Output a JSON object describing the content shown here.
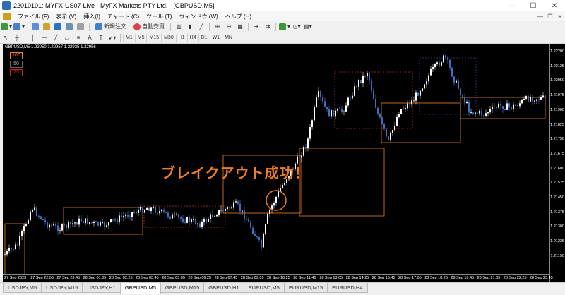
{
  "window": {
    "title": "22010101: MYFX-US07-Live - MyFX Markets PTY Ltd. - [GBPUSD,M5]",
    "minimize": "—",
    "maximize": "☐",
    "close": "✕"
  },
  "menu": [
    "ファイル (F)",
    "表示 (V)",
    "挿入(I)",
    "チャート (C)",
    "ツール (T)",
    "ウィンドウ (W)",
    "ヘルプ (H)"
  ],
  "menu_controls": [
    "—",
    "❐",
    "✕"
  ],
  "toolbar1": {
    "new_order": "新規注文",
    "auto_trade": "自動売買"
  },
  "toolbar2": {
    "timeframes": [
      "M1",
      "M5",
      "M15",
      "M30",
      "H1",
      "H4",
      "D1",
      "W1",
      "MN"
    ]
  },
  "chart": {
    "symbol_info": "GBPUSD,M5  1.22950 1.22957 1.22935 1.22956",
    "legend": [
      {
        "label": "100",
        "color": "#f07c24"
      },
      {
        "label": "50",
        "color": "#888888"
      },
      {
        "label": "25",
        "color": "#cc2222"
      }
    ],
    "overlay_text": "ブレイクアウト成功！",
    "price_scale": [
      "1.22200",
      "1.22125",
      "1.22050",
      "1.21975",
      "1.21900",
      "1.21825",
      "1.21750",
      "1.21675",
      "1.21600",
      "1.21525",
      "1.21450",
      "1.21375",
      "1.21300",
      "1.21225",
      "1.21150"
    ],
    "time_scale": [
      "27 Sep 2023",
      "27 Sep 22:55",
      "27 Sep 23:45",
      "28 Sep 01:05",
      "28 Sep 02:25",
      "28 Sep 03:45",
      "28 Sep 05:05",
      "28 Sep 06:25",
      "28 Sep 07:45",
      "28 Sep 09:05",
      "28 Sep 10:25",
      "28 Sep 11:45",
      "28 Sep 13:05",
      "28 Sep 14:25",
      "28 Sep 15:45",
      "28 Sep 17:05",
      "28 Sep 18:25",
      "28 Sep 19:45",
      "28 Sep 21:05",
      "28 Sep 22:25",
      "28 Sep 23:45"
    ]
  },
  "tabs": [
    "USDJPY,M5",
    "USDJPY,M15",
    "USDJPY,H1",
    "GBPUSD,M5",
    "GBPUSD,M15",
    "GBPUSD,H1",
    "EURUSD,M5",
    "EURUSD,M15",
    "EURUSD,H4"
  ],
  "active_tab": "GBPUSD,M5"
}
